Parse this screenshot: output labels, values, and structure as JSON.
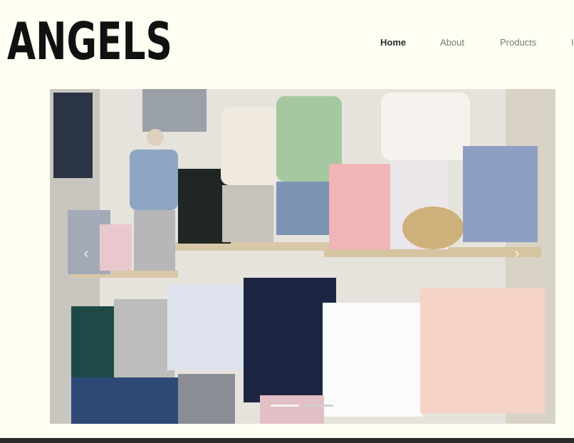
{
  "header": {
    "brand": "ANGELS",
    "nav": [
      {
        "label": "Home",
        "active": true
      },
      {
        "label": "About",
        "active": false
      },
      {
        "label": "Products",
        "active": false
      },
      {
        "label": "I",
        "active": false
      }
    ]
  },
  "hero": {
    "prev_icon": "chevron-left-icon",
    "next_icon": "chevron-right-icon",
    "prev_glyph": "‹",
    "next_glyph": "›",
    "slides_total": 2,
    "current_slide": 1
  },
  "colors": {
    "background": "#fefef3",
    "brand_text": "#111111",
    "nav_active": "#2a2a2a",
    "nav_inactive": "#7a7a72"
  }
}
